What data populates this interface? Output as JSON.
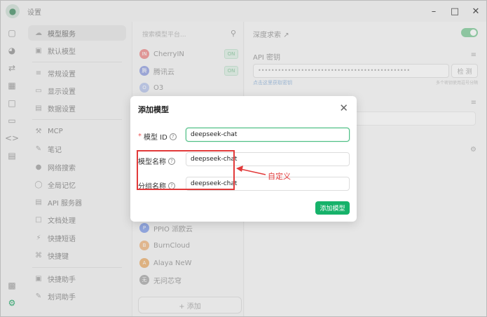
{
  "window": {
    "title": "设置",
    "avatar_icon": "user-avatar-icon",
    "controls": [
      "minimize",
      "maximize",
      "close"
    ]
  },
  "nav": {
    "items": [
      {
        "label": "模型服务",
        "icon": "cloud-icon",
        "active": true
      },
      {
        "label": "默认模型",
        "icon": "cube-icon"
      },
      {
        "label": "常规设置",
        "icon": "sliders-icon"
      },
      {
        "label": "显示设置",
        "icon": "monitor-icon"
      },
      {
        "label": "数据设置",
        "icon": "database-icon"
      },
      {
        "label": "MCP",
        "icon": "plug-icon"
      },
      {
        "label": "笔记",
        "icon": "note-icon"
      },
      {
        "label": "网络搜索",
        "icon": "globe-icon"
      },
      {
        "label": "全局记忆",
        "icon": "brain-icon"
      },
      {
        "label": "API 服务器",
        "icon": "server-icon"
      },
      {
        "label": "文档处理",
        "icon": "document-icon"
      },
      {
        "label": "快捷短语",
        "icon": "zap-icon"
      },
      {
        "label": "快捷键",
        "icon": "command-icon"
      },
      {
        "label": "快捷助手",
        "icon": "assistant-icon"
      },
      {
        "label": "划词助手",
        "icon": "pen-icon"
      }
    ]
  },
  "providers": {
    "search_placeholder": "搜索模型平台...",
    "items": [
      {
        "name": "CherryIN",
        "badge": "ON",
        "logo_color": "#f2a3a3",
        "logo_text": "IN"
      },
      {
        "name": "腾讯云",
        "badge": "ON",
        "logo_color": "#a9b4e8",
        "logo_text": "腾"
      },
      {
        "name": "O3",
        "badge": "",
        "logo_color": "#c7d2f1",
        "logo_text": "O"
      },
      {
        "name": "PPIO 派欧云",
        "badge": "",
        "logo_color": "#9db4f0",
        "logo_text": "P"
      },
      {
        "name": "BurnCloud",
        "badge": "",
        "logo_color": "#f3c69b",
        "logo_text": "B"
      },
      {
        "name": "Alaya NeW",
        "badge": "",
        "logo_color": "#f0c08b",
        "logo_text": "A"
      },
      {
        "name": "无问芯穹",
        "badge": "",
        "logo_color": "#bbbbbb",
        "logo_text": "无"
      }
    ],
    "add_label": "+ 添加"
  },
  "detail": {
    "title": "深度求索",
    "api_key_label": "API 密钥",
    "api_key_value": "••••••••••••••••••••••••••••••••••••••••••••••",
    "check_label": "检 测",
    "get_key_link": "点击这里获取密钥",
    "hint": "多个密钥使用逗号分隔"
  },
  "modal": {
    "title": "添加模型",
    "fields": {
      "model_id": {
        "label": "模型 ID",
        "value": "deepseek-chat"
      },
      "model_name": {
        "label": "模型名称",
        "value": "deepseek-chat"
      },
      "group_name": {
        "label": "分组名称",
        "value": "deepseek-chat"
      }
    },
    "submit_label": "添加模型"
  },
  "annotation": {
    "text": "自定义",
    "color": "#e23a3a"
  },
  "colors": {
    "accent": "#16b26a",
    "focus_border": "#4dbf85"
  }
}
